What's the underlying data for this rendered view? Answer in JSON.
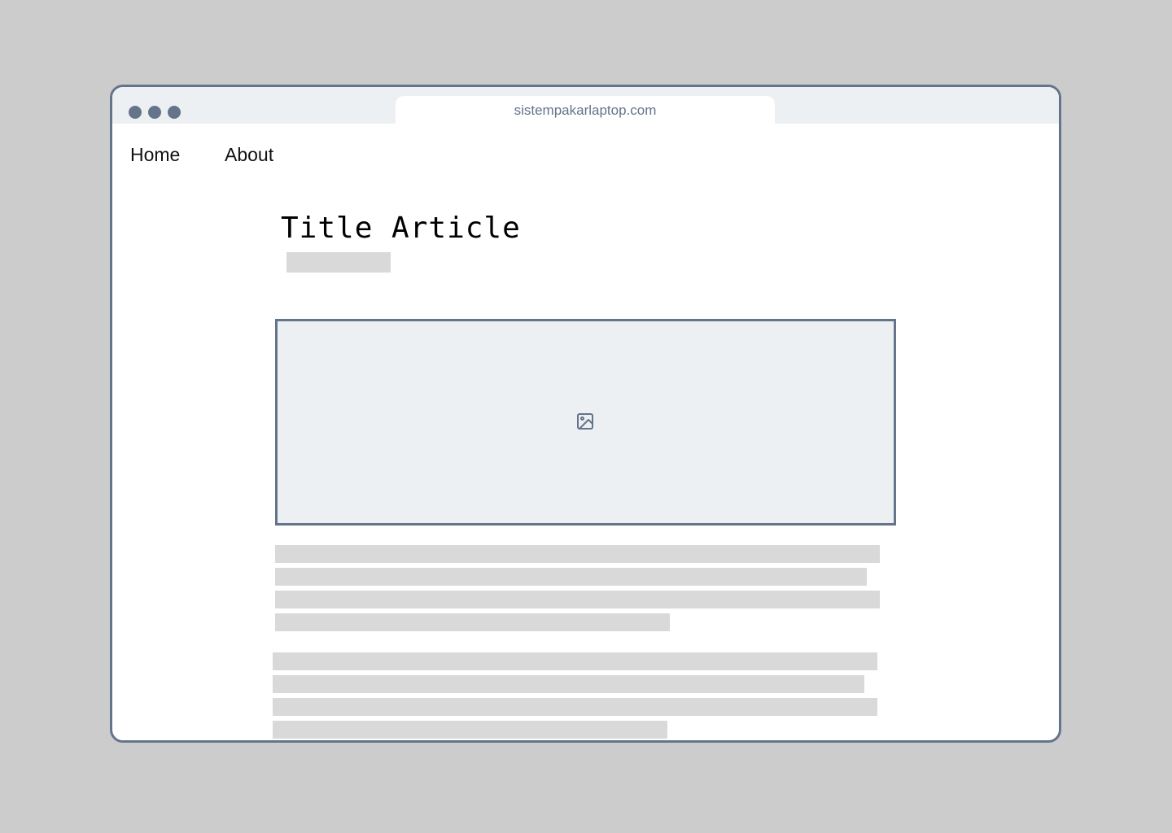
{
  "browser": {
    "url": "sistempakarlaptop.com"
  },
  "nav": {
    "items": [
      {
        "label": "Home"
      },
      {
        "label": "About"
      }
    ]
  },
  "article": {
    "title": "Title Article",
    "image_icon": "image-icon"
  },
  "colors": {
    "background": "#cccccc",
    "frame": "#64748b",
    "chrome": "#edf0f3",
    "placeholder": "#d9d9d9"
  }
}
